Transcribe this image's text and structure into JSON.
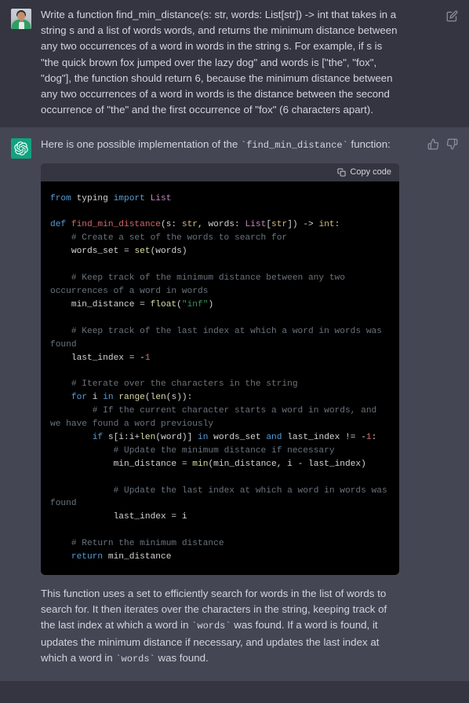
{
  "theme": {
    "user_bg": "#343541",
    "assistant_bg": "#444654",
    "code_bg": "#000000",
    "code_header_bg": "#343541",
    "text": "#d1d5db",
    "brand_green": "#10a37f"
  },
  "user_message": {
    "avatar_name": "user-avatar-photo",
    "text": "Write a function find_min_distance(s: str, words: List[str]) -> int that takes in a string s and a list of words words, and returns the minimum distance between any two occurrences of a word in words in the string s. For example, if s is \"the quick brown fox jumped over the lazy dog\" and words is [\"the\", \"fox\", \"dog\"], the function should return 6, because the minimum distance between any two occurrences of a word in words is the distance between the second occurrence of \"the\" and the first occurrence of \"fox\" (6 characters apart).",
    "edit_icon": "edit-pencil-square-icon"
  },
  "assistant_message": {
    "avatar_name": "chatgpt-logo-icon",
    "intro_before": "Here is one possible implementation of the ",
    "intro_code": "`find_min_distance`",
    "intro_after": " function:",
    "thumbs_up_icon": "thumbs-up-icon",
    "thumbs_down_icon": "thumbs-down-icon",
    "codeblock": {
      "copy_label": "Copy code",
      "copy_icon": "clipboard-icon",
      "language": "python",
      "lines": [
        [
          [
            "from ",
            "kw"
          ],
          [
            "typing ",
            "plain"
          ],
          [
            "import ",
            "kw"
          ],
          [
            "List",
            "cls"
          ]
        ],
        [],
        [
          [
            "def ",
            "def"
          ],
          [
            "find_min_distance",
            "fn"
          ],
          [
            "(s: ",
            "plain"
          ],
          [
            "str",
            "type"
          ],
          [
            ", words: ",
            "plain"
          ],
          [
            "List",
            "cls"
          ],
          [
            "[",
            "op"
          ],
          [
            "str",
            "type"
          ],
          [
            "]) -> ",
            "plain"
          ],
          [
            "int",
            "type"
          ],
          [
            ":",
            "plain"
          ]
        ],
        [
          [
            "    # Create a set of the words to search for",
            "cmt"
          ]
        ],
        [
          [
            "    words_set = ",
            "plain"
          ],
          [
            "set",
            "built"
          ],
          [
            "(words)",
            "plain"
          ]
        ],
        [],
        [
          [
            "    # Keep track of the minimum distance between any two occurrences of a word in words",
            "cmt"
          ]
        ],
        [
          [
            "    min_distance = ",
            "plain"
          ],
          [
            "float",
            "built"
          ],
          [
            "(",
            "plain"
          ],
          [
            "\"inf\"",
            "str"
          ],
          [
            ")",
            "plain"
          ]
        ],
        [],
        [
          [
            "    # Keep track of the last index at which a word in words was found",
            "cmt"
          ]
        ],
        [
          [
            "    last_index = ",
            "plain"
          ],
          [
            "-",
            "op"
          ],
          [
            "1",
            "num"
          ]
        ],
        [],
        [
          [
            "    # Iterate over the characters in the string",
            "cmt"
          ]
        ],
        [
          [
            "    for",
            "kw"
          ],
          [
            " i ",
            "plain"
          ],
          [
            "in",
            "kw"
          ],
          [
            " ",
            "plain"
          ],
          [
            "range",
            "built"
          ],
          [
            "(",
            "plain"
          ],
          [
            "len",
            "built"
          ],
          [
            "(s)):",
            "plain"
          ]
        ],
        [
          [
            "        # If the current character starts a word in words, and we have found a word previously",
            "cmt"
          ]
        ],
        [
          [
            "        if",
            "kw"
          ],
          [
            " s[i:i+",
            "plain"
          ],
          [
            "len",
            "built"
          ],
          [
            "(word)] ",
            "plain"
          ],
          [
            "in",
            "kw"
          ],
          [
            " words_set ",
            "plain"
          ],
          [
            "and",
            "kw"
          ],
          [
            " last_index != ",
            "plain"
          ],
          [
            "-",
            "op"
          ],
          [
            "1",
            "num"
          ],
          [
            ":",
            "plain"
          ]
        ],
        [
          [
            "            # Update the minimum distance if necessary",
            "cmt"
          ]
        ],
        [
          [
            "            min_distance = ",
            "plain"
          ],
          [
            "min",
            "built"
          ],
          [
            "(min_distance, i - last_index)",
            "plain"
          ]
        ],
        [],
        [
          [
            "            # Update the last index at which a word in words was found",
            "cmt"
          ]
        ],
        [
          [
            "            last_index = i",
            "plain"
          ]
        ],
        [],
        [
          [
            "    # Return the minimum distance",
            "cmt"
          ]
        ],
        [
          [
            "    return",
            "kw"
          ],
          [
            " min_distance",
            "plain"
          ]
        ]
      ]
    },
    "closing_paragraph": {
      "part1": "This function uses a set to efficiently search for words in the list of words to search for. It then iterates over the characters in the string, keeping track of the last index at which a word in ",
      "code1": "`words`",
      "part2": " was found. If a word is found, it updates the minimum distance if necessary, and updates the last index at which a word in ",
      "code2": "`words`",
      "part3": " was found."
    }
  }
}
